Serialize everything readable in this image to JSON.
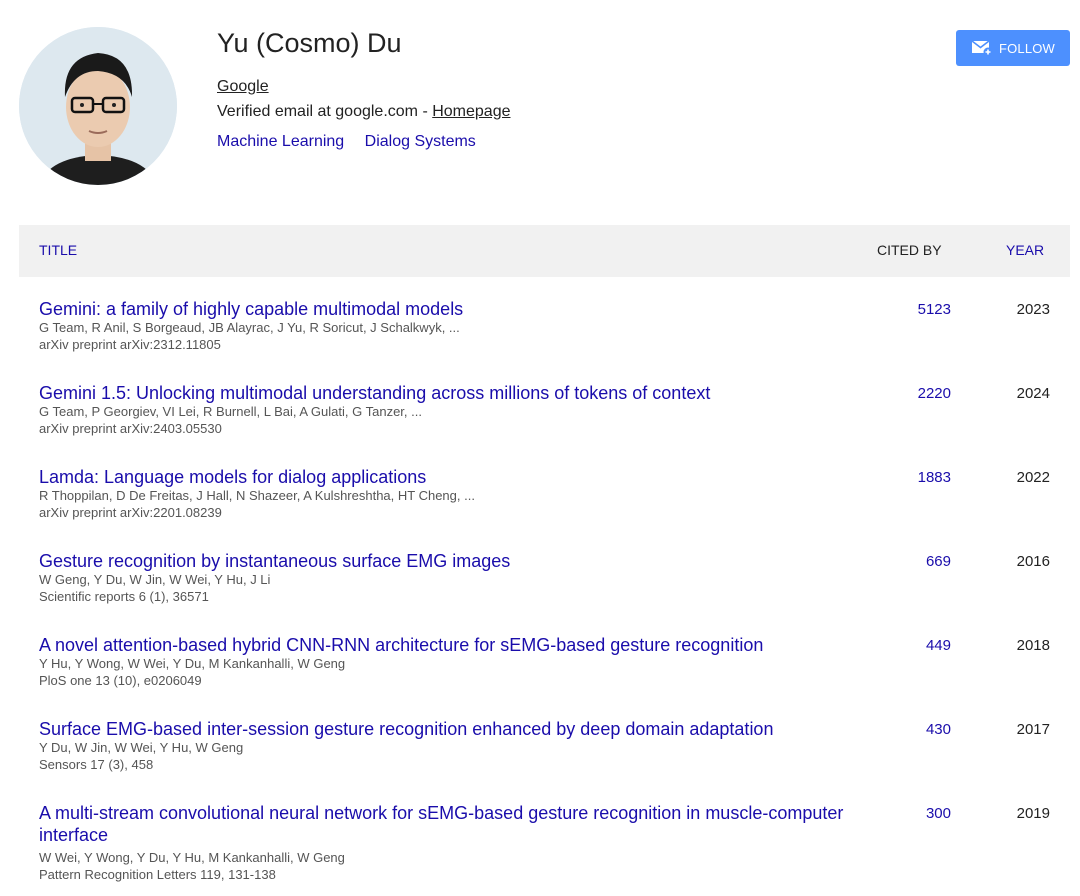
{
  "profile": {
    "name": "Yu (Cosmo) Du",
    "affiliation": "Google",
    "email_text": "Verified email at google.com - ",
    "homepage_label": "Homepage",
    "interests": [
      "Machine Learning",
      "Dialog Systems"
    ],
    "follow_label": "FOLLOW"
  },
  "table": {
    "col_title": "TITLE",
    "col_cited": "CITED BY",
    "col_year": "YEAR",
    "rows": [
      {
        "title": "Gemini: a family of highly capable multimodal models",
        "authors": "G Team, R Anil, S Borgeaud, JB Alayrac, J Yu, R Soricut, J Schalkwyk, ...",
        "venue": "arXiv preprint arXiv:2312.11805",
        "cited": "5123",
        "year": "2023"
      },
      {
        "title": "Gemini 1.5: Unlocking multimodal understanding across millions of tokens of context",
        "authors": "G Team, P Georgiev, VI Lei, R Burnell, L Bai, A Gulati, G Tanzer, ...",
        "venue": "arXiv preprint arXiv:2403.05530",
        "cited": "2220",
        "year": "2024"
      },
      {
        "title": "Lamda: Language models for dialog applications",
        "authors": "R Thoppilan, D De Freitas, J Hall, N Shazeer, A Kulshreshtha, HT Cheng, ...",
        "venue": "arXiv preprint arXiv:2201.08239",
        "cited": "1883",
        "year": "2022"
      },
      {
        "title": "Gesture recognition by instantaneous surface EMG images",
        "authors": "W Geng, Y Du, W Jin, W Wei, Y Hu, J Li",
        "venue": "Scientific reports 6 (1), 36571",
        "cited": "669",
        "year": "2016"
      },
      {
        "title": "A novel attention-based hybrid CNN-RNN architecture for sEMG-based gesture recognition",
        "authors": "Y Hu, Y Wong, W Wei, Y Du, M Kankanhalli, W Geng",
        "venue": "PloS one 13 (10), e0206049",
        "cited": "449",
        "year": "2018"
      },
      {
        "title": "Surface EMG-based inter-session gesture recognition enhanced by deep domain adaptation",
        "authors": "Y Du, W Jin, W Wei, Y Hu, W Geng",
        "venue": "Sensors 17 (3), 458",
        "cited": "430",
        "year": "2017"
      },
      {
        "title": "A multi-stream convolutional neural network for sEMG-based gesture recognition in muscle-computer interface",
        "authors": "W Wei, Y Wong, Y Du, Y Hu, M Kankanhalli, W Geng",
        "venue": "Pattern Recognition Letters 119, 131-138",
        "cited": "300",
        "year": "2019"
      }
    ]
  },
  "colors": {
    "link": "#1a0dab",
    "follow_button": "#4d90fe",
    "header_bg": "#f1f1f1"
  }
}
